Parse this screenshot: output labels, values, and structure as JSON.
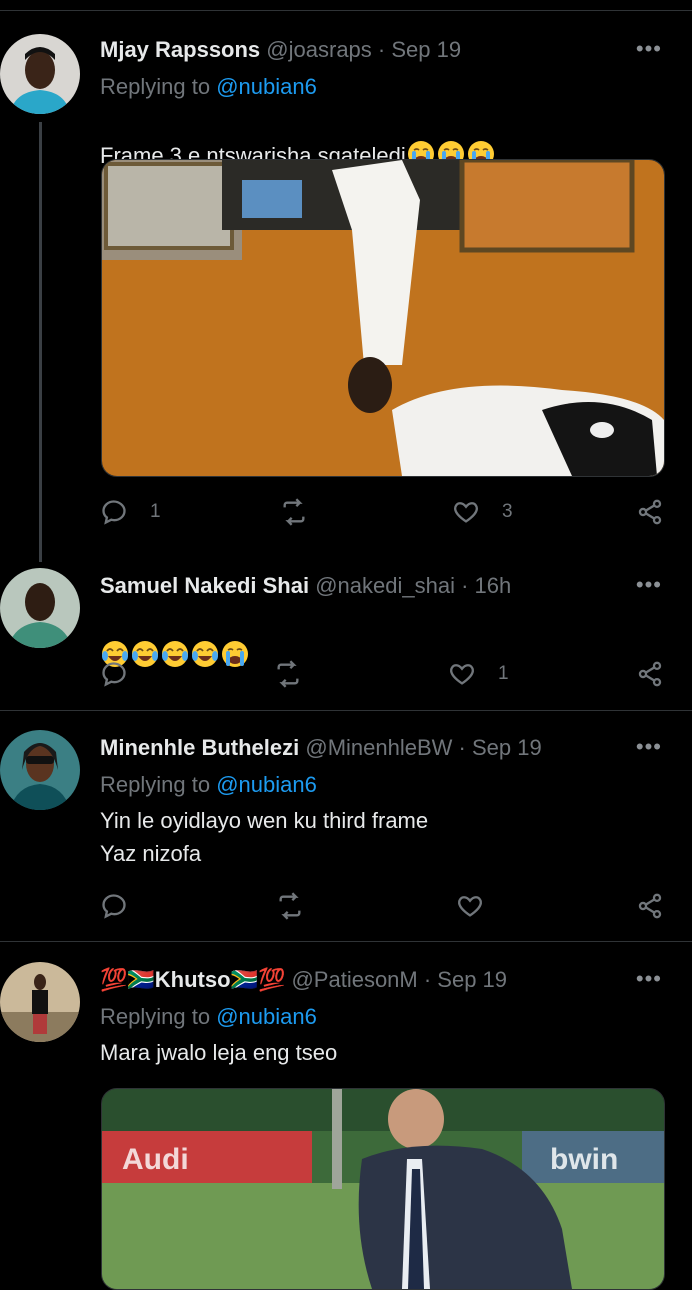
{
  "tweets": [
    {
      "name": "Mjay Rapssons",
      "handle": "@joasraps · Sep 19",
      "replying_prefix": "Replying to ",
      "replying_to": "@nubian6",
      "text": "Frame 3 e ntswarisha sgateledi",
      "emoji": [
        "loudly-crying-face",
        "loudly-crying-face",
        "loudly-crying-face"
      ],
      "replies": "1",
      "retweets": "",
      "likes": "3",
      "more": "•••"
    },
    {
      "name": "Samuel Nakedi Shai",
      "handle": "@nakedi_shai · 16h",
      "text": "",
      "emoji": [
        "face-with-tears-of-joy",
        "face-with-tears-of-joy",
        "face-with-tears-of-joy",
        "face-with-tears-of-joy",
        "loudly-crying-face"
      ],
      "replies": "",
      "retweets": "",
      "likes": "1",
      "more": "•••"
    },
    {
      "name": "Minenhle Buthelezi",
      "handle": "@MinenhleBW · Sep 19",
      "replying_prefix": "Replying to ",
      "replying_to": "@nubian6",
      "text": "Yin le oyidlayo wen ku third frame\nYaz nizofa",
      "replies": "",
      "retweets": "",
      "likes": "",
      "more": "•••"
    },
    {
      "name": "💯🇿🇦Khutso🇿🇦💯",
      "handle": "@PatiesonM · Sep 19",
      "replying_prefix": "Replying to ",
      "replying_to": "@nubian6",
      "text": "Mara jwalo leja eng tseo",
      "more": "•••"
    }
  ],
  "media": {
    "stadium_sign_1": "Audi",
    "stadium_sign_2": "bwin"
  },
  "colors": {
    "background": "#000000",
    "text": "#e7e9ea",
    "secondary": "#71767b",
    "link": "#1d9bf0",
    "divider": "#2f3336"
  }
}
